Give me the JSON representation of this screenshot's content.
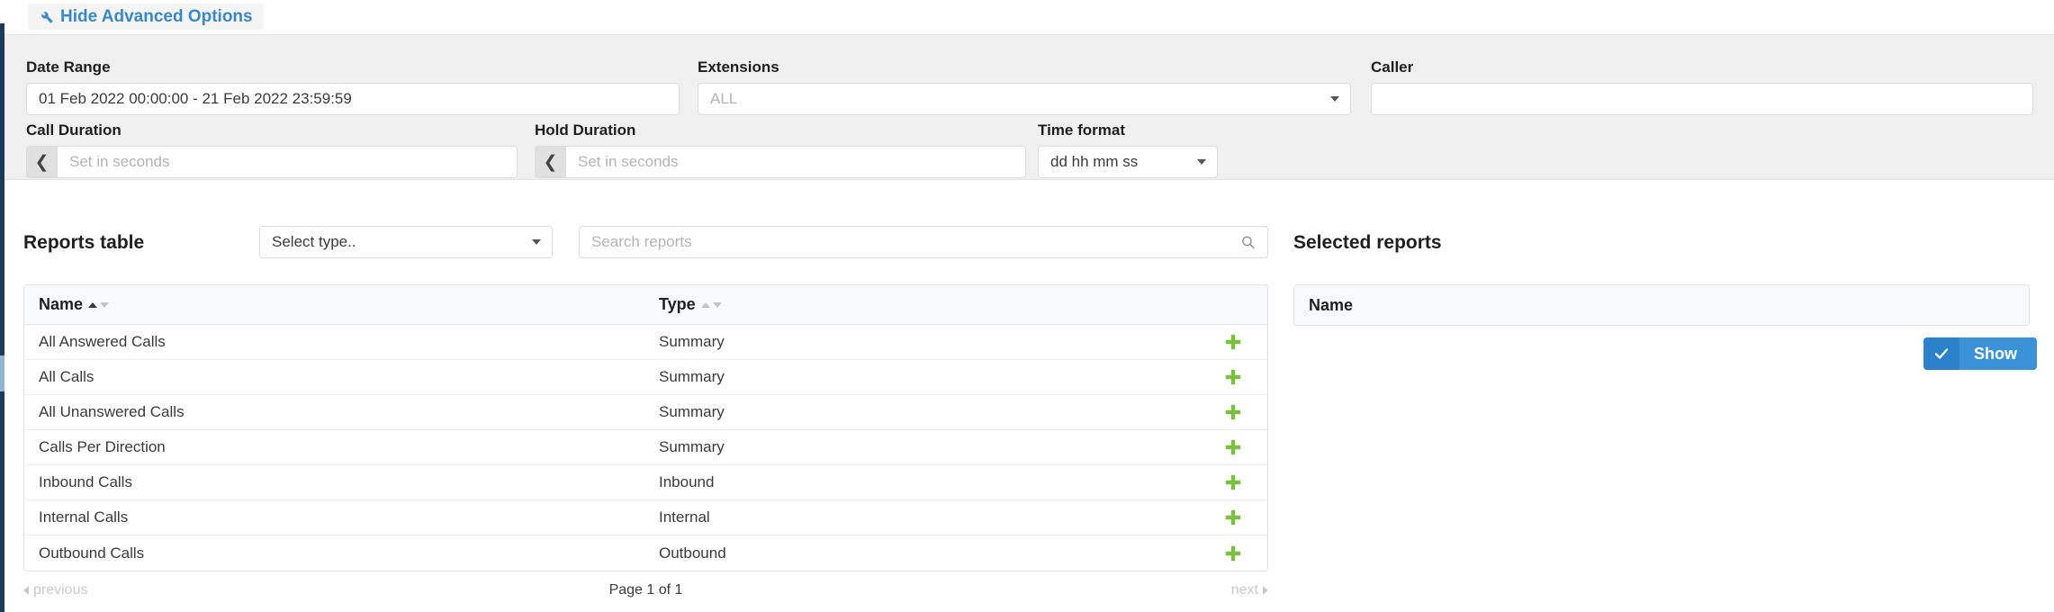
{
  "advanced": {
    "toggle_label": "Hide Advanced Options",
    "toggle_icon": "wrench-icon"
  },
  "filters": {
    "date_range": {
      "label": "Date Range",
      "value": "01 Feb 2022 00:00:00 - 21 Feb 2022 23:59:59"
    },
    "extensions": {
      "label": "Extensions",
      "placeholder": "ALL",
      "value": ""
    },
    "caller": {
      "label": "Caller",
      "placeholder": "",
      "value": ""
    },
    "call_duration": {
      "label": "Call Duration",
      "prev_icon": "chevron-left-icon",
      "placeholder": "Set in seconds",
      "value": ""
    },
    "hold_duration": {
      "label": "Hold Duration",
      "prev_icon": "chevron-left-icon",
      "placeholder": "Set in seconds",
      "value": ""
    },
    "time_format": {
      "label": "Time format",
      "value": "dd hh mm ss"
    }
  },
  "reports": {
    "title": "Reports table",
    "type_filter": {
      "value": "Select type..",
      "icon": "chevron-down-icon"
    },
    "search": {
      "placeholder": "Search reports",
      "value": "",
      "icon": "search-icon"
    },
    "columns": [
      "Name",
      "Type"
    ],
    "sort": {
      "column": "Name",
      "direction": "asc"
    },
    "add_icon": "plus-icon",
    "rows": [
      {
        "name": "All Answered Calls",
        "type": "Summary"
      },
      {
        "name": "All Calls",
        "type": "Summary"
      },
      {
        "name": "All Unanswered Calls",
        "type": "Summary"
      },
      {
        "name": "Calls Per Direction",
        "type": "Summary"
      },
      {
        "name": "Inbound Calls",
        "type": "Inbound"
      },
      {
        "name": "Internal Calls",
        "type": "Internal"
      },
      {
        "name": "Outbound Calls",
        "type": "Outbound"
      }
    ],
    "pagination": {
      "previous": "previous",
      "info": "Page 1 of 1",
      "next": "next"
    }
  },
  "selected": {
    "title": "Selected reports",
    "column_name": "Name",
    "rows": [],
    "show_button": {
      "label": "Show",
      "icon": "check-icon"
    }
  },
  "colors": {
    "accent_blue": "#3a87c8",
    "button_blue": "#3c92d8",
    "button_blue_dark": "#2b82cb",
    "plus_green": "#7ac143",
    "panel_bg": "#f0f0f0",
    "rail": "#1b3a5c"
  }
}
